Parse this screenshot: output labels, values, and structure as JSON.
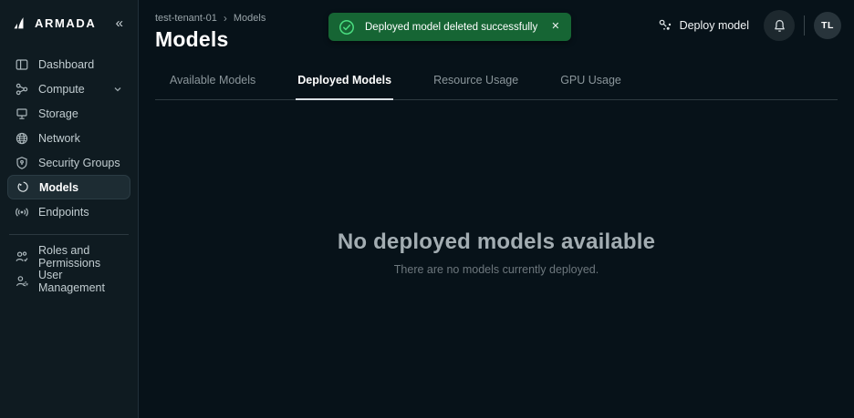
{
  "brand": {
    "name": "ARMADA",
    "collapse_glyph": "«"
  },
  "sidebar": {
    "items": [
      {
        "label": "Dashboard",
        "icon": "dashboard-icon"
      },
      {
        "label": "Compute",
        "icon": "compute-icon",
        "has_submenu": true
      },
      {
        "label": "Storage",
        "icon": "storage-icon"
      },
      {
        "label": "Network",
        "icon": "network-icon"
      },
      {
        "label": "Security Groups",
        "icon": "security-groups-icon"
      },
      {
        "label": "Models",
        "icon": "models-icon",
        "active": true
      },
      {
        "label": "Endpoints",
        "icon": "endpoints-icon"
      }
    ],
    "secondary_items": [
      {
        "label": "Roles and Permissions",
        "icon": "roles-permissions-icon"
      },
      {
        "label": "User Management",
        "icon": "user-management-icon"
      }
    ]
  },
  "header": {
    "breadcrumb": {
      "parent": "test-tenant-01",
      "separator": "›",
      "current": "Models"
    },
    "title": "Models",
    "deploy_button_label": "Deploy model",
    "avatar_initials": "TL"
  },
  "toast": {
    "message": "Deployed model deleted successfully",
    "close_glyph": "✕",
    "icon": "check-circle-icon",
    "bg_color": "#166534",
    "check_color": "#4ade80"
  },
  "tabs": [
    {
      "label": "Available Models",
      "active": false
    },
    {
      "label": "Deployed Models",
      "active": true
    },
    {
      "label": "Resource Usage",
      "active": false
    },
    {
      "label": "GPU Usage",
      "active": false
    }
  ],
  "empty_state": {
    "title": "No deployed models available",
    "subtitle": "There are no models currently deployed."
  },
  "colors": {
    "sidebar_bg": "#0f1b21",
    "main_bg": "#071219",
    "active_item_bg": "#1d2c33",
    "toast_bg": "#166534",
    "success_green": "#4ade80"
  }
}
